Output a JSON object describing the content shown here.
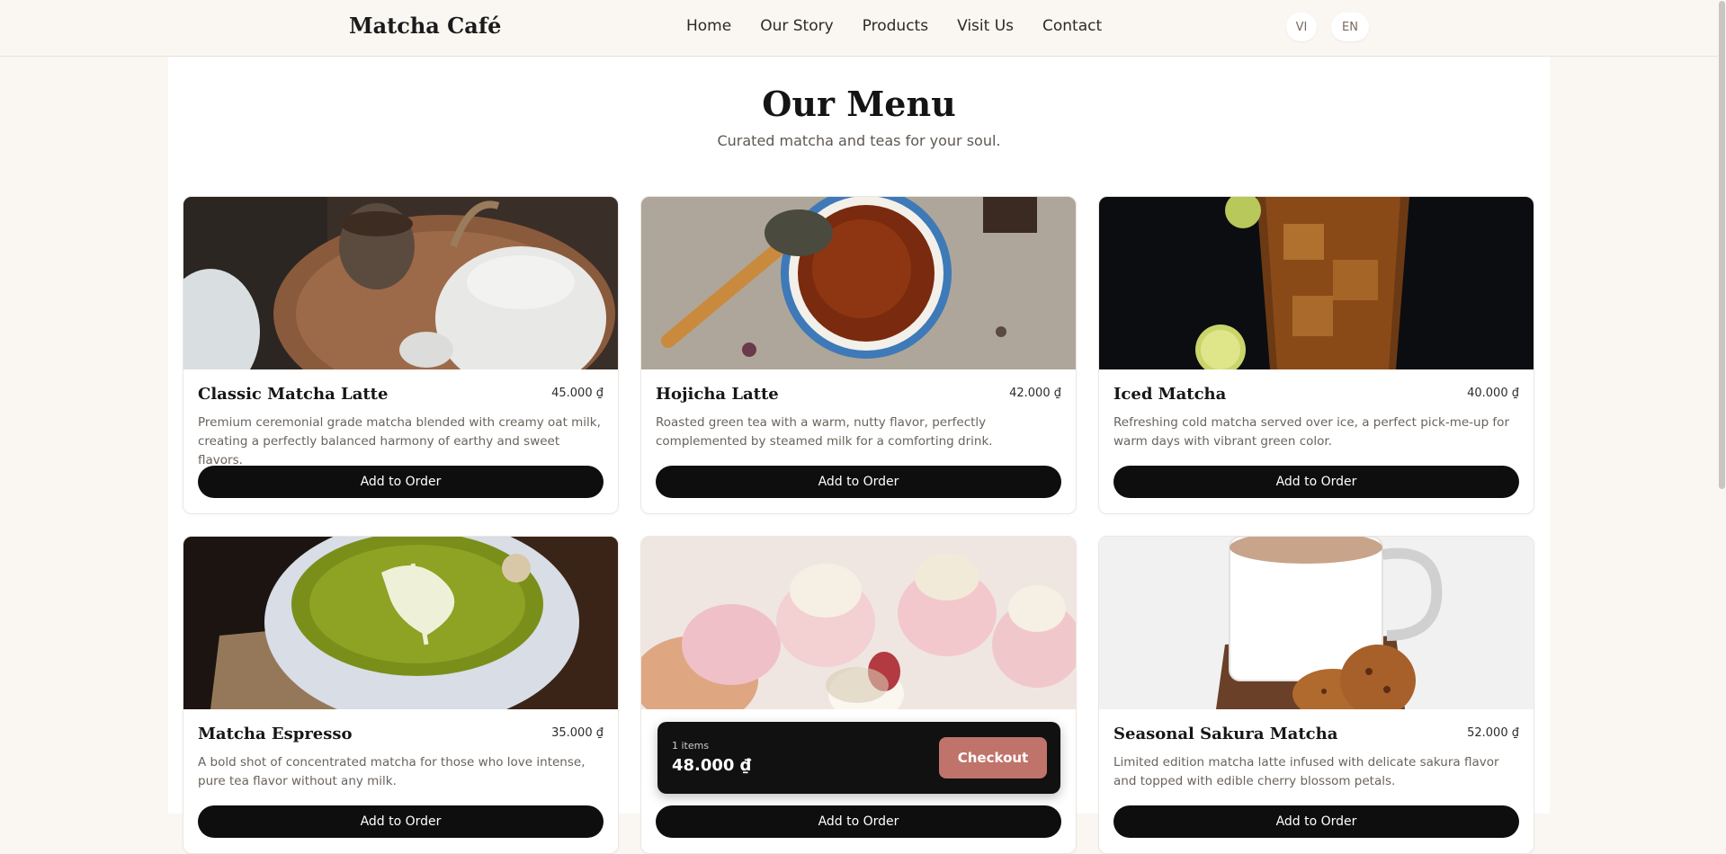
{
  "navbar": {
    "brand": "Matcha Café",
    "links": [
      "Home",
      "Our Story",
      "Products",
      "Visit Us",
      "Contact"
    ],
    "languages": [
      "VI",
      "EN"
    ]
  },
  "menu": {
    "title": "Our Menu",
    "subtitle": "Curated matcha and teas for your soul.",
    "items": [
      {
        "name": "Classic Matcha Latte",
        "price": "45.000 ₫",
        "description": "Premium ceremonial grade matcha blended with creamy oat milk, creating a perfectly balanced harmony of earthy and sweet flavors.",
        "button": "Add to Order",
        "image": "teapot-and-cup-photo"
      },
      {
        "name": "Hojicha Latte",
        "price": "42.000 ₫",
        "description": "Roasted green tea with a warm, nutty flavor, perfectly complemented by steamed milk for a comforting drink.",
        "button": "Add to Order",
        "image": "tea-cup-on-linen-photo"
      },
      {
        "name": "Iced Matcha",
        "price": "40.000 ₫",
        "description": "Refreshing cold matcha served over ice, a perfect pick-me-up for warm days with vibrant green color.",
        "button": "Add to Order",
        "image": "iced-tea-glass-photo"
      },
      {
        "name": "Matcha Espresso",
        "price": "35.000 ₫",
        "description": "A bold shot of concentrated matcha for those who love intense, pure tea flavor without any milk.",
        "button": "Add to Order",
        "image": "matcha-latte-art-photo"
      },
      {
        "name": "",
        "price": "",
        "description": "",
        "button": "Add to Order",
        "image": "cupcakes-photo"
      },
      {
        "name": "Seasonal Sakura Matcha",
        "price": "52.000 ₫",
        "description": "Limited edition matcha latte infused with delicate sakura flavor and topped with edible cherry blossom petals.",
        "button": "Add to Order",
        "image": "tea-mug-and-cookies-photo"
      }
    ]
  },
  "cart": {
    "count_text": "1 items",
    "total": "48.000 ₫",
    "checkout_label": "Checkout"
  },
  "colors": {
    "page_background": "#faf7f2",
    "button_dark": "#0e0e0e",
    "checkout_accent": "#c0736a"
  }
}
